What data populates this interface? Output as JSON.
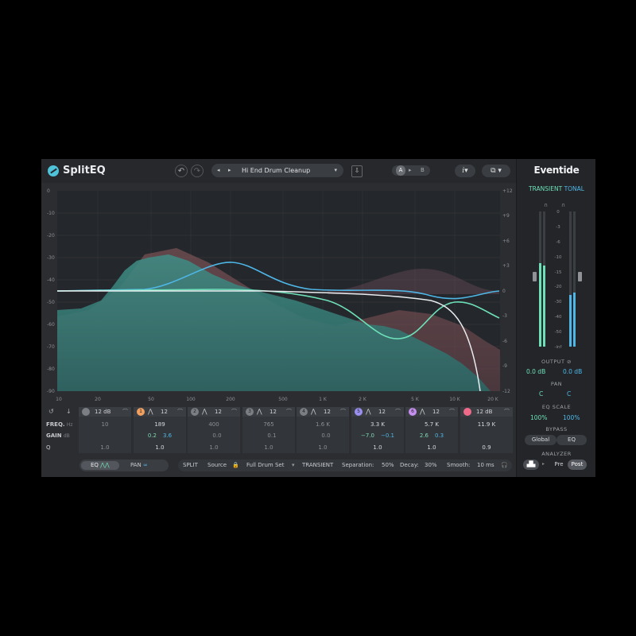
{
  "app": {
    "title": "SplitEQ",
    "brand": "Eventide"
  },
  "header": {
    "undo_icon": "undo-icon",
    "redo_icon": "redo-icon",
    "preset_name": "Hi End Drum Cleanup",
    "ab": {
      "a": "A",
      "arrow": "▸",
      "b": "B"
    },
    "info_label": "i",
    "route_icon": "routing-icon"
  },
  "eq_display": {
    "db_left": [
      "0",
      "-10",
      "-20",
      "-30",
      "-40",
      "-50",
      "-60",
      "-70",
      "-80",
      "-90"
    ],
    "db_right": [
      "+12",
      "+9",
      "+6",
      "+3",
      "0",
      "-3",
      "-6",
      "-9",
      "-12"
    ],
    "freq_labels": [
      "10",
      "20",
      "50",
      "100",
      "200",
      "500",
      "1 K",
      "2 K",
      "5 K",
      "10 K",
      "20 K"
    ]
  },
  "band_labels": {
    "freq": "FREQ.",
    "freq_unit": "Hz",
    "gain": "GAIN",
    "gain_unit": "dB",
    "q": "Q"
  },
  "bands": [
    {
      "num": "",
      "slope": "12 dB",
      "freq": "10",
      "gain_t": "",
      "gain_n": "",
      "q": "1.0",
      "active": false
    },
    {
      "num": "1",
      "slope": "12",
      "freq": "189",
      "gain_t": "0.2",
      "gain_n": "3.6",
      "q": "1.0",
      "active": true,
      "color": "#f0a060"
    },
    {
      "num": "2",
      "slope": "12",
      "freq": "400",
      "gain_t": "",
      "gain_n": "0.0",
      "q": "1.0",
      "active": false
    },
    {
      "num": "3",
      "slope": "12",
      "freq": "765",
      "gain_t": "",
      "gain_n": "0.1",
      "q": "1.0",
      "active": false
    },
    {
      "num": "4",
      "slope": "12",
      "freq": "1.6 K",
      "gain_t": "",
      "gain_n": "0.0",
      "q": "1.0",
      "active": false
    },
    {
      "num": "5",
      "slope": "12",
      "freq": "3.3 K",
      "gain_t": "−7.0",
      "gain_n": "−0.1",
      "q": "1.0",
      "active": true,
      "color": "#9b8ff0"
    },
    {
      "num": "6",
      "slope": "12",
      "freq": "5.7 K",
      "gain_t": "2.6",
      "gain_n": "0.3",
      "q": "1.0",
      "active": true,
      "color": "#c58ff0"
    },
    {
      "num": "",
      "slope": "12 dB",
      "freq": "11.9 K",
      "gain_t": "",
      "gain_n": "",
      "q": "0.9",
      "active": true,
      "color": "#f06a8a"
    }
  ],
  "footer": {
    "eq_label": "EQ",
    "pan_label": "PAN",
    "split": "SPLIT",
    "source_label": "Source",
    "source_value": "Full Drum Set",
    "transient": "TRANSIENT",
    "separation_label": "Separation:",
    "separation_value": "50%",
    "decay_label": "Decay:",
    "decay_value": "30%",
    "smooth_label": "Smooth:",
    "smooth_value": "10 ms"
  },
  "side": {
    "mode_transient": "TRANSIENT",
    "mode_tonal": "TONAL",
    "meter_scale": [
      "0",
      "-3",
      "-6",
      "-10",
      "-15",
      "-20",
      "-30",
      "-40",
      "-50",
      "-inf"
    ],
    "meter_levels": {
      "transient": [
        0.62,
        0.6
      ],
      "tonal": [
        0.38,
        0.4
      ]
    },
    "output_label": "OUTPUT",
    "output_t": "0.0 dB",
    "output_n": "0.0 dB",
    "pan_label": "PAN",
    "pan_t": "C",
    "pan_n": "C",
    "eqscale_label": "EQ SCALE",
    "eqscale_t": "100%",
    "eqscale_n": "100%",
    "bypass_label": "BYPASS",
    "bypass_global": "Global",
    "bypass_eq": "EQ",
    "analyzer_label": "ANALYZER",
    "analyzer_pre": "Pre",
    "analyzer_post": "Post"
  },
  "colors": {
    "transient": "#6ee0b8",
    "tonal": "#4fb7e8",
    "accent_line": "#e8ecef"
  }
}
